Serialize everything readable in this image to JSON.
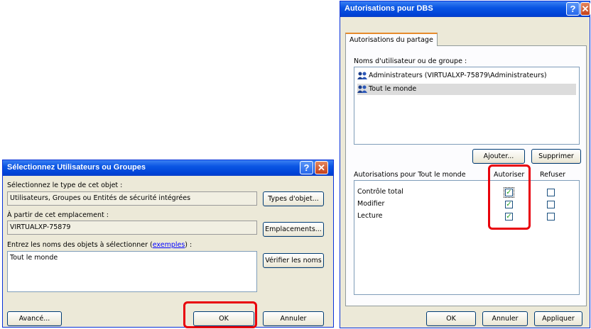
{
  "dialog_select": {
    "title": "Sélectionnez Utilisateurs ou Groupes",
    "object_type_label": "Sélectionnez le type de cet objet :",
    "object_type_value": "Utilisateurs, Groupes ou Entités de sécurité intégrées",
    "object_types_button": "Types d'objet...",
    "location_label": "À partir de cet emplacement :",
    "location_value": "VIRTUALXP-75879",
    "locations_button": "Emplacements...",
    "names_label_prefix": "Entrez les noms des objets à sélectionner (",
    "names_label_link": "exemples",
    "names_label_suffix": ") :",
    "names_value": "Tout le monde",
    "check_names_button": "Vérifier les noms",
    "advanced_button": "Avancé...",
    "ok_button": "OK",
    "cancel_button": "Annuler"
  },
  "dialog_perm": {
    "title": "Autorisations pour DBS",
    "tab_label": "Autorisations du partage",
    "users_label": "Noms d'utilisateur ou de groupe :",
    "users": [
      {
        "name": "Administrateurs (VIRTUALXP-75879\\Administrateurs)",
        "icon": "users-group-icon",
        "selected": false
      },
      {
        "name": "Tout le monde",
        "icon": "users-group-icon",
        "selected": true
      }
    ],
    "add_button": "Ajouter...",
    "remove_button": "Supprimer",
    "perms_label": "Autorisations pour Tout le monde",
    "allow_header": "Autoriser",
    "deny_header": "Refuser",
    "permissions": [
      {
        "name": "Contrôle total",
        "allow": true,
        "deny": false
      },
      {
        "name": "Modifier",
        "allow": true,
        "deny": false
      },
      {
        "name": "Lecture",
        "allow": true,
        "deny": false
      }
    ],
    "ok_button": "OK",
    "cancel_button": "Annuler",
    "apply_button": "Appliquer"
  },
  "icons": {
    "help": "?",
    "close": "✕",
    "check": "✓"
  },
  "colors": {
    "highlight": "#e8000b",
    "titlebar": "#0a55e3"
  }
}
